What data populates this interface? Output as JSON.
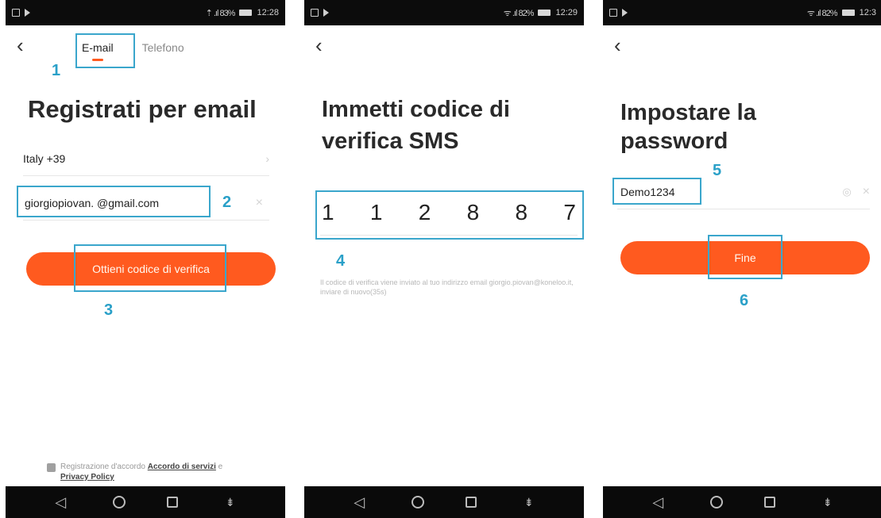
{
  "status_bars": [
    {
      "signal": "⇡ .ıl 83%",
      "time": "12:28"
    },
    {
      "signal": "ᯤ .ıl 82%",
      "time": "12:29"
    },
    {
      "signal": "ᯤ .ıl 82%",
      "time": "12:3"
    }
  ],
  "screen1": {
    "tabs": {
      "email": "E-mail",
      "phone": "Telefono"
    },
    "title": "Registrati per email",
    "country": "Italy +39",
    "email_value": "giorgiopiovan.  @gmail.com",
    "cta": "Ottieni codice di verifica",
    "agreement_prefix": "Registrazione d'accordo",
    "agreement_terms": "Accordo di servizi",
    "agreement_and": "e",
    "agreement_privacy": "Privacy Policy"
  },
  "screen2": {
    "title": "Immetti codice di verifica SMS",
    "digits": [
      "1",
      "1",
      "2",
      "8",
      "8",
      "7"
    ],
    "info": "Il codice di verifica viene inviato al tuo indirizzo email giorgio.piovan@koneloo.it, inviare di nuovo(35s)"
  },
  "screen3": {
    "title": "Impostare la password",
    "password": "Demo1234",
    "cta": "Fine"
  },
  "annotations": [
    "1",
    "2",
    "3",
    "4",
    "5",
    "6"
  ],
  "icons": {
    "back": "‹",
    "chevron": "›",
    "clear": "×",
    "eye": "◎"
  },
  "colors": {
    "accent": "#ff5a1f",
    "annotation": "#3aa6cc"
  }
}
